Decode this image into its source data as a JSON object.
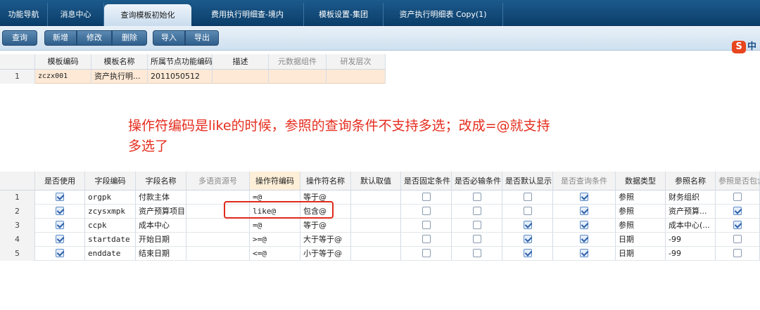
{
  "tabs": [
    {
      "label": "功能导航",
      "active": false
    },
    {
      "label": "消息中心",
      "active": false
    },
    {
      "label": "查询模板初始化",
      "active": true
    },
    {
      "label": "费用执行明细查-境内",
      "active": false
    },
    {
      "label": "模板设置-集团",
      "active": false
    },
    {
      "label": "资产执行明细表 Copy(1)",
      "active": false
    }
  ],
  "toolbar": {
    "query": "查询",
    "add": "新增",
    "edit": "修改",
    "delete": "删除",
    "import": "导入",
    "export": "导出"
  },
  "ime": {
    "logo": "S",
    "mode": "中"
  },
  "template_grid": {
    "headers": [
      "模板编码",
      "模板名称",
      "所属节点功能编码",
      "描述",
      "元数据组件",
      "研发层次"
    ],
    "rows": [
      {
        "num": "1",
        "code": "zczx001",
        "name": "资产执行明...",
        "node": "2011050512",
        "desc": "",
        "meta": "",
        "level": ""
      }
    ]
  },
  "annotation": {
    "line1": "操作符编码是like的时候，参照的查询条件不支持多选；改成=@就支持",
    "line2": "多选了"
  },
  "field_grid": {
    "headers": [
      "是否使用",
      "字段编码",
      "字段名称",
      "多语资源号",
      "操作符编码",
      "操作符名称",
      "默认取值",
      "是否固定条件",
      "是否必输条件",
      "是否默认显示",
      "是否查询条件",
      "数据类型",
      "参照名称",
      "参照是否包含"
    ],
    "rows": [
      {
        "num": "1",
        "used": true,
        "code": "orgpk",
        "name": "付款主体",
        "res": "",
        "op": "=@",
        "opname": "等于@",
        "def": "",
        "fixed": false,
        "required": false,
        "show": false,
        "query": true,
        "type": "参照",
        "ref": "财务组织",
        "incl": false
      },
      {
        "num": "2",
        "used": true,
        "code": "zcysxmpk",
        "name": "资产预算项目",
        "res": "",
        "op": "like@",
        "opname": "包含@",
        "def": "",
        "fixed": false,
        "required": false,
        "show": false,
        "query": true,
        "type": "参照",
        "ref": "资产预算...",
        "incl": true
      },
      {
        "num": "3",
        "used": true,
        "code": "ccpk",
        "name": "成本中心",
        "res": "",
        "op": "=@",
        "opname": "等于@",
        "def": "",
        "fixed": false,
        "required": false,
        "show": true,
        "query": true,
        "type": "参照",
        "ref": "成本中心(...",
        "incl": true
      },
      {
        "num": "4",
        "used": true,
        "code": "startdate",
        "name": "开始日期",
        "res": "",
        "op": ">=@",
        "opname": "大于等于@",
        "def": "",
        "fixed": false,
        "required": false,
        "show": true,
        "query": true,
        "type": "日期",
        "ref": "-99",
        "incl": false
      },
      {
        "num": "5",
        "used": true,
        "code": "enddate",
        "name": "结束日期",
        "res": "",
        "op": "<=@",
        "opname": "小于等于@",
        "def": "",
        "fixed": false,
        "required": false,
        "show": true,
        "query": true,
        "type": "日期",
        "ref": "-99",
        "incl": false
      }
    ]
  }
}
